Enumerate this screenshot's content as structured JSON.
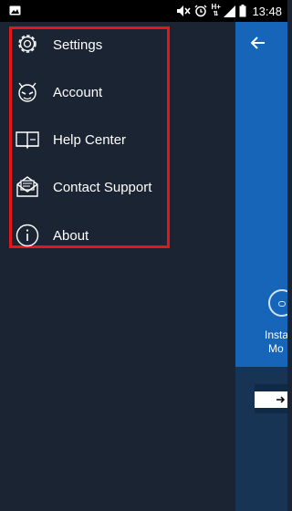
{
  "status_bar": {
    "time": "13:48",
    "network": "H+",
    "icons": [
      "gallery-icon",
      "mute-icon",
      "alarm-icon",
      "network-arrows-icon",
      "signal-icon",
      "battery-icon"
    ]
  },
  "drawer": {
    "items": [
      {
        "label": "Settings",
        "icon": "gear-icon"
      },
      {
        "label": "Account",
        "icon": "avatar-icon"
      },
      {
        "label": "Help Center",
        "icon": "book-icon"
      },
      {
        "label": "Contact Support",
        "icon": "mail-icon"
      },
      {
        "label": "About",
        "icon": "info-icon"
      }
    ],
    "highlight_color": "#e8141c"
  },
  "background_app": {
    "back_icon": "arrow-left-icon",
    "text_line1": "Insta",
    "text_line2": "Mo",
    "next_icon": "arrow-right-icon",
    "hero_color": "#1665b8"
  }
}
